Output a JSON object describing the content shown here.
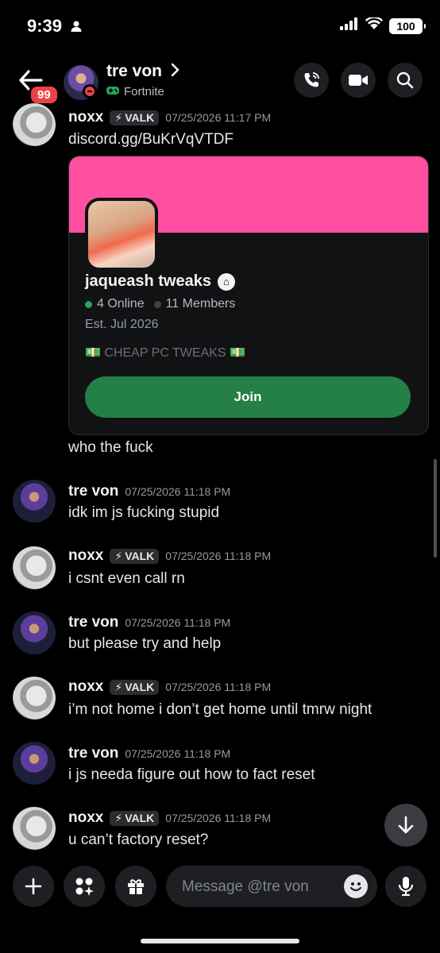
{
  "status_bar": {
    "time": "9:39",
    "battery": "100"
  },
  "header": {
    "unread_count": "99",
    "user_name": "tre von",
    "activity": "Fortnite"
  },
  "invite": {
    "server_name": "jaqueash tweaks",
    "online": "4 Online",
    "members": "11 Members",
    "established": "Est. Jul 2026",
    "description": "💵 CHEAP PC TWEAKS 💵",
    "join_label": "Join"
  },
  "messages": [
    {
      "author": "noxx",
      "tag": "VALK",
      "time": "07/25/2026 11:17 PM",
      "text": "discord.gg/BuKrVqVTDF"
    },
    {
      "author": "",
      "tag": "",
      "time": "",
      "text": "who the fuck"
    },
    {
      "author": "tre von",
      "tag": "",
      "time": "07/25/2026 11:18 PM",
      "text": "idk im js fucking stupid"
    },
    {
      "author": "noxx",
      "tag": "VALK",
      "time": "07/25/2026 11:18 PM",
      "text": "i csnt even call rn"
    },
    {
      "author": "tre von",
      "tag": "",
      "time": "07/25/2026 11:18 PM",
      "text": "but please try and help"
    },
    {
      "author": "noxx",
      "tag": "VALK",
      "time": "07/25/2026 11:18 PM",
      "text": "i’m not home i don’t get home until tmrw night"
    },
    {
      "author": "tre von",
      "tag": "",
      "time": "07/25/2026 11:18 PM",
      "text": "i js needa figure out how to fact reset"
    },
    {
      "author": "noxx",
      "tag": "VALK",
      "time": "07/25/2026 11:18 PM",
      "text": "u can’t factory reset?"
    }
  ],
  "composer": {
    "placeholder": "Message @tre von"
  },
  "colors": {
    "online": "#23a55a",
    "banner": "#ff4fa0",
    "join": "#248046",
    "badge": "#ed4245"
  }
}
